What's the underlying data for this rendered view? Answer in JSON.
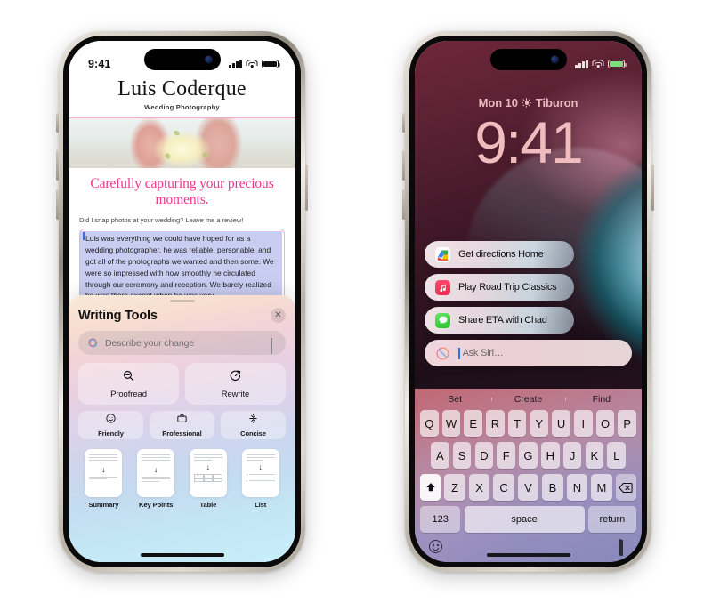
{
  "left_phone": {
    "status_bar": {
      "time": "9:41",
      "signal_icon": "cellular-bars-icon",
      "wifi_icon": "wifi-icon",
      "battery_icon": "battery-icon"
    },
    "website": {
      "brand": "Luis Coderque",
      "brand_subtitle": "Wedding Photography",
      "hero_image_alt": "bride-holding-bouquet-photo",
      "tagline": "Carefully capturing your precious moments.",
      "prompt": "Did I snap photos at your wedding? Leave me a review!",
      "review_text": "Luis was everything we could have hoped for as a wedding photographer, he was reliable, personable, and got all of the photographs we wanted and then some. We were so impressed with how smoothly he circulated through our ceremony and reception. We barely realized he was there except when he was very"
    },
    "writing_tools": {
      "title": "Writing Tools",
      "close_label": "✕",
      "input_placeholder": "Describe your change",
      "input_value": "",
      "siri_icon": "siri-glyph-icon",
      "mic_icon": "microphone-icon",
      "primary_actions": [
        {
          "label": "Proofread",
          "icon": "magnifier-minus-icon"
        },
        {
          "label": "Rewrite",
          "icon": "rewrite-clock-icon"
        }
      ],
      "tone_actions": [
        {
          "label": "Friendly",
          "icon": "smiley-face-icon"
        },
        {
          "label": "Professional",
          "icon": "briefcase-icon"
        },
        {
          "label": "Concise",
          "icon": "concise-arrows-icon"
        }
      ],
      "format_actions": [
        {
          "label": "Summary",
          "icon": "document-summary-icon"
        },
        {
          "label": "Key Points",
          "icon": "document-keypoints-icon"
        },
        {
          "label": "Table",
          "icon": "document-table-icon"
        },
        {
          "label": "List",
          "icon": "document-list-icon"
        }
      ]
    }
  },
  "right_phone": {
    "status_bar": {
      "signal_icon": "cellular-bars-icon",
      "wifi_icon": "wifi-icon",
      "battery_icon": "battery-icon"
    },
    "lock_screen": {
      "date": "Mon 10",
      "weather_icon": "sun-icon",
      "location": "Tiburon",
      "time": "9:41"
    },
    "siri_suggestions": [
      {
        "label": "Get directions Home",
        "icon": "maps-app-icon"
      },
      {
        "label": "Play Road Trip Classics",
        "icon": "music-app-icon"
      },
      {
        "label": "Share ETA with Chad",
        "icon": "messages-app-icon"
      }
    ],
    "ask_siri": {
      "placeholder": "Ask Siri…",
      "value": "",
      "icon": "siri-circle-icon"
    },
    "keyboard": {
      "predictions": [
        "Set",
        "Create",
        "Find"
      ],
      "row1": [
        "Q",
        "W",
        "E",
        "R",
        "T",
        "Y",
        "U",
        "I",
        "O",
        "P"
      ],
      "row2": [
        "A",
        "S",
        "D",
        "F",
        "G",
        "H",
        "J",
        "K",
        "L"
      ],
      "row3_shift": "shift-icon",
      "row3": [
        "Z",
        "X",
        "C",
        "V",
        "B",
        "N",
        "M"
      ],
      "row3_delete": "delete-key-icon",
      "numbers_key": "123",
      "space_key": "space",
      "return_key": "return",
      "emoji_icon": "emoji-keyboard-icon",
      "dictation_icon": "dictation-microphone-icon"
    }
  },
  "colors": {
    "brand_pink": "#f0368c",
    "review_highlight": "#c9cdf2",
    "review_border": "#ffa8d2",
    "lock_text": "#f0bcc0",
    "caret_blue": "#2f6fe0"
  }
}
